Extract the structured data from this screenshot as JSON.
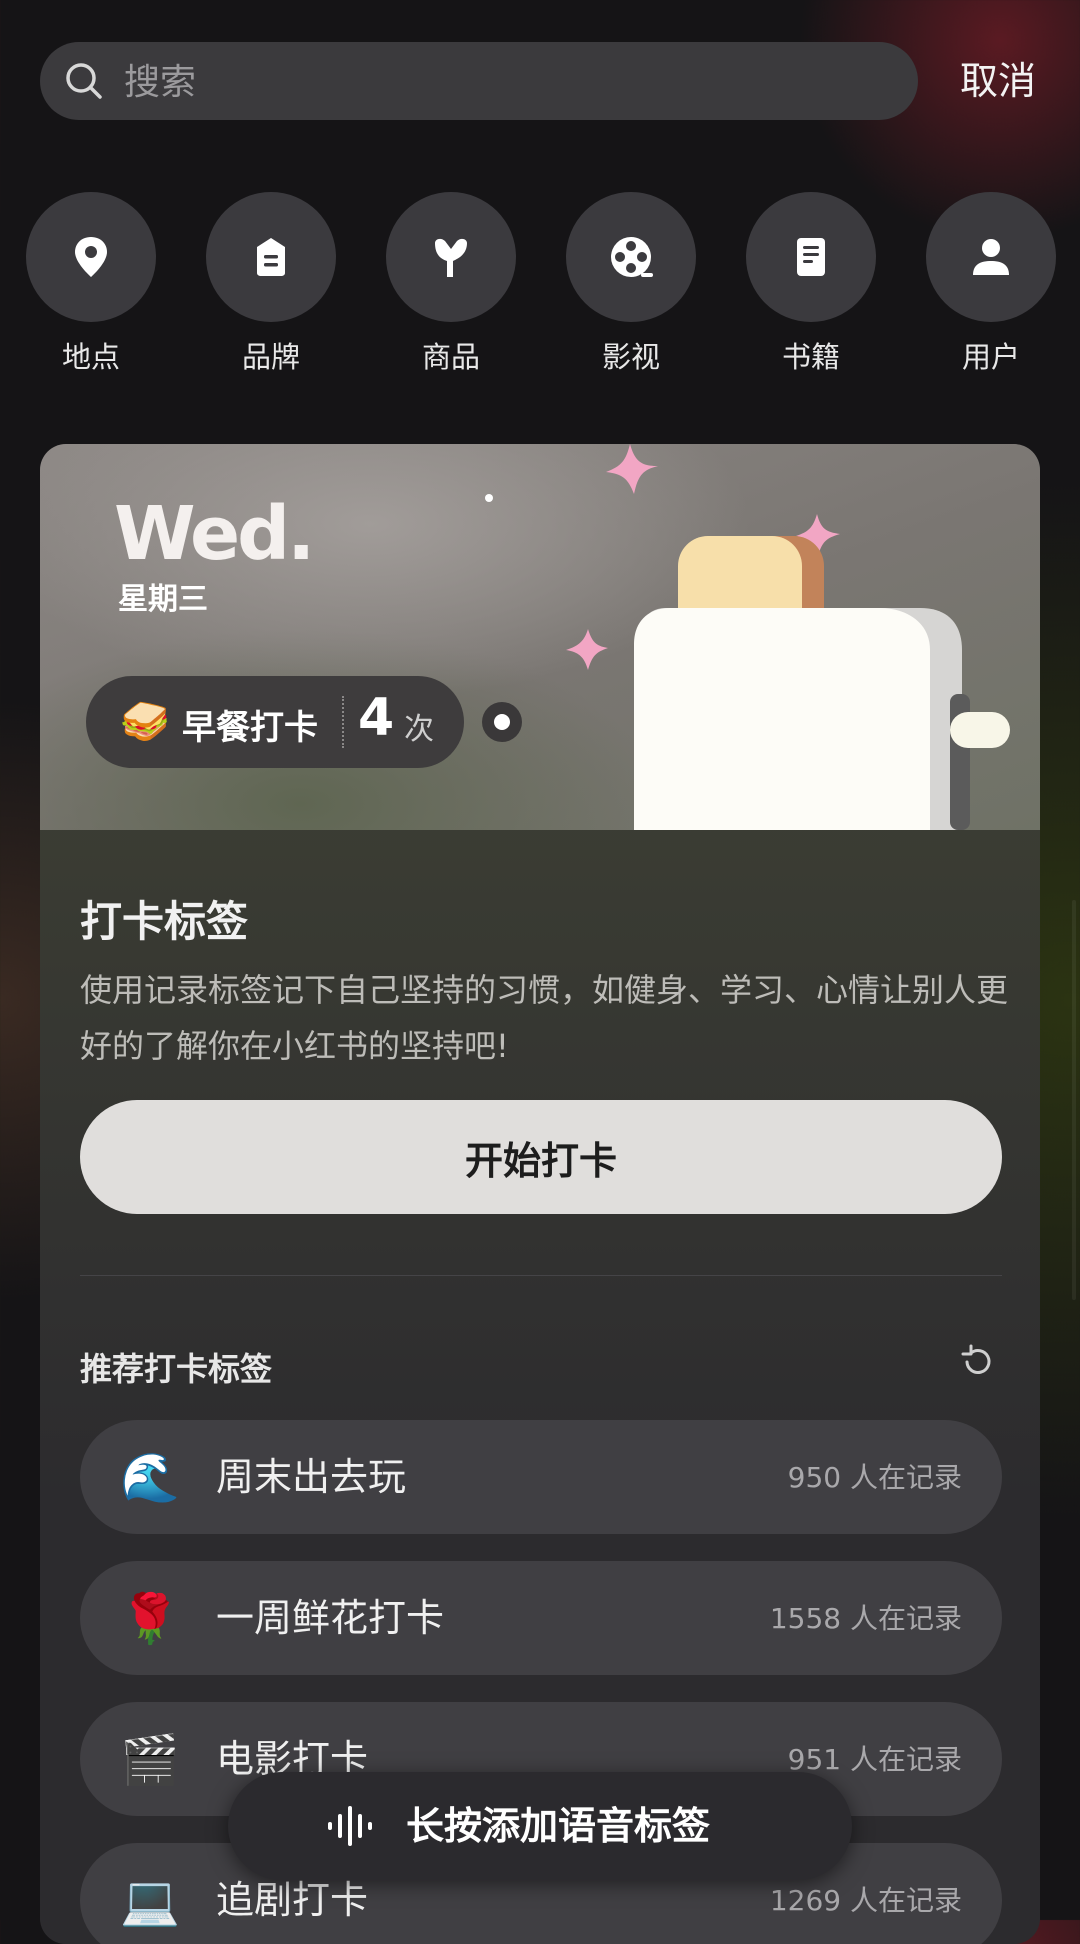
{
  "search": {
    "placeholder": "搜索",
    "value": "",
    "cancel_label": "取消"
  },
  "categories": [
    {
      "label": "地点",
      "icon": "location-pin-icon"
    },
    {
      "label": "品牌",
      "icon": "brand-bag-icon"
    },
    {
      "label": "商品",
      "icon": "product-icon"
    },
    {
      "label": "影视",
      "icon": "film-reel-icon"
    },
    {
      "label": "书籍",
      "icon": "book-icon"
    },
    {
      "label": "用户",
      "icon": "user-icon"
    }
  ],
  "banner": {
    "day_en": "Wed.",
    "day_cn": "星期三",
    "checkin_emoji": "🥪",
    "checkin_name": "早餐打卡",
    "checkin_count": "4",
    "checkin_unit": "次"
  },
  "card": {
    "title": "打卡标签",
    "description": "使用记录标签记下自己坚持的习惯，如健身、学习、心情让别人更好的了解你在小红书的坚持吧!",
    "start_button": "开始打卡"
  },
  "recommended": {
    "title": "推荐打卡标签",
    "items": [
      {
        "emoji": "🌊",
        "name": "周末出去玩",
        "count": "950 人在记录"
      },
      {
        "emoji": "🌹",
        "name": "一周鲜花打卡",
        "count": "1558 人在记录"
      },
      {
        "emoji": "🎬",
        "name": "电影打卡",
        "count": "951 人在记录"
      },
      {
        "emoji": "💻",
        "name": "追剧打卡",
        "count": "1269 人在记录"
      }
    ]
  },
  "voice_button": {
    "label": "长按添加语音标签"
  },
  "colors": {
    "background": "#151416",
    "card": "#2c2b2e",
    "button": "#e0dedc",
    "accent_pink": "#f2a6c4"
  }
}
